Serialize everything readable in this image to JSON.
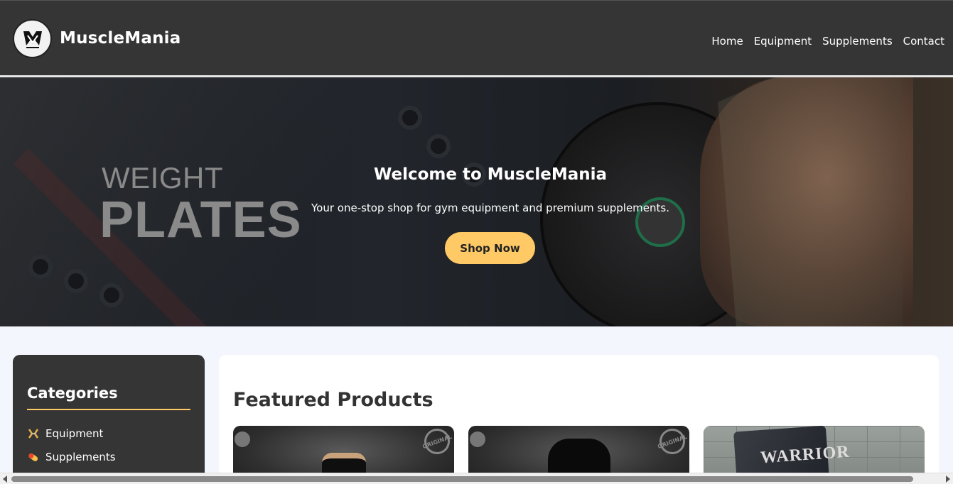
{
  "header": {
    "brand": "MuscleMania",
    "logo_icon": "muscle-mania-logo",
    "nav": [
      {
        "label": "Home"
      },
      {
        "label": "Equipment"
      },
      {
        "label": "Supplements"
      },
      {
        "label": "Contact"
      }
    ]
  },
  "hero": {
    "banner_word_1": "WEIGHT",
    "banner_word_2": "PLATES",
    "title": "Welcome to MuscleMania",
    "subtitle": "Your one-stop shop for gym equipment and premium supplements.",
    "cta_label": "Shop Now"
  },
  "sidebar": {
    "title": "Categories",
    "items": [
      {
        "label": "Equipment",
        "icon": "dumbbell-icon"
      },
      {
        "label": "Supplements",
        "icon": "pill-icon"
      }
    ]
  },
  "main": {
    "title": "Featured Products",
    "cards": [
      {
        "stamp": "ORIGINAL"
      },
      {
        "stamp": "ORIGINAL"
      },
      {
        "bag_text": "WARRIOR"
      }
    ]
  },
  "colors": {
    "header_bg": "#353535",
    "accent": "#ffc966",
    "page_bg": "#f3f6fc"
  }
}
